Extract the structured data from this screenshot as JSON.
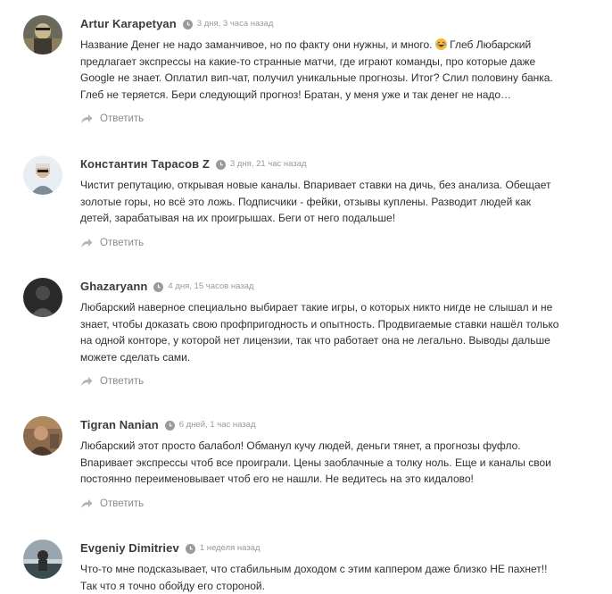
{
  "comments": [
    {
      "author": "Artur Karapetyan",
      "time": "3 дня, 3 часа назад",
      "text_before_emoji": "Название Денег не надо заманчивое, но по факту они нужны, и много. ",
      "text_after_emoji": " Глеб Любарский предлагает экспрессы на какие-то странные матчи, где играют команды, про которые даже Google не знает. Оплатил вип-чат, получил уникальные прогнозы. Итог? Слил половину банка. Глеб не теряется. Бери следующий прогноз! Братан, у меня уже и так денег не надо…",
      "reply": "Ответить",
      "avatar_colors": [
        "#6b6a5a",
        "#c9b98d"
      ]
    },
    {
      "author": "Константин Тарасов Z",
      "time": "3 дня, 21 час назад",
      "text": "Чистит репутацию, открывая новые каналы. Впаривает ставки на дичь, без анализа. Обещает золотые горы, но всё это ложь. Подписчики - фейки, отзывы куплены. Разводит людей как детей, зарабатывая на их проигрышах. Беги от него подальше!",
      "reply": "Ответить",
      "avatar_colors": [
        "#e9eef3",
        "#7d8a98"
      ]
    },
    {
      "author": "Ghazaryann",
      "time": "4 дня, 15 часов назад",
      "text": "Любарский наверное специально выбирает такие игры, о которых никто нигде не слышал и не знает, чтобы доказать свою профпригодность и опытность. Продвигаемые ставки нашёл только на одной конторе, у которой нет лицензии, так что работает она не легально. Выводы дальше можете сделать сами.",
      "reply": "Ответить",
      "avatar_colors": [
        "#2a2a2a",
        "#5a5a5a"
      ]
    },
    {
      "author": "Tigran Nanian",
      "time": "6 дней, 1 час назад",
      "text": "Любарский этот просто балабол! Обманул кучу людей, деньги тянет, а прогнозы фуфло. Впаривает экспрессы чтоб все проиграли. Цены заоблачные а толку ноль. Еще и каналы свои постоянно переименовывает чтоб его не нашли. Не ведитесь на это кидалово!",
      "reply": "Ответить",
      "avatar_colors": [
        "#8a6a4a",
        "#4a3a2e"
      ]
    },
    {
      "author": "Evgeniy Dimitriev",
      "time": "1 неделя назад",
      "text": "Что-то мне подсказывает, что стабильным доходом с этим каппером даже близко НЕ пахнет!! Так что я точно обойду его стороной.",
      "avatar_colors": [
        "#9aa6ad",
        "#3c4a52"
      ]
    }
  ]
}
